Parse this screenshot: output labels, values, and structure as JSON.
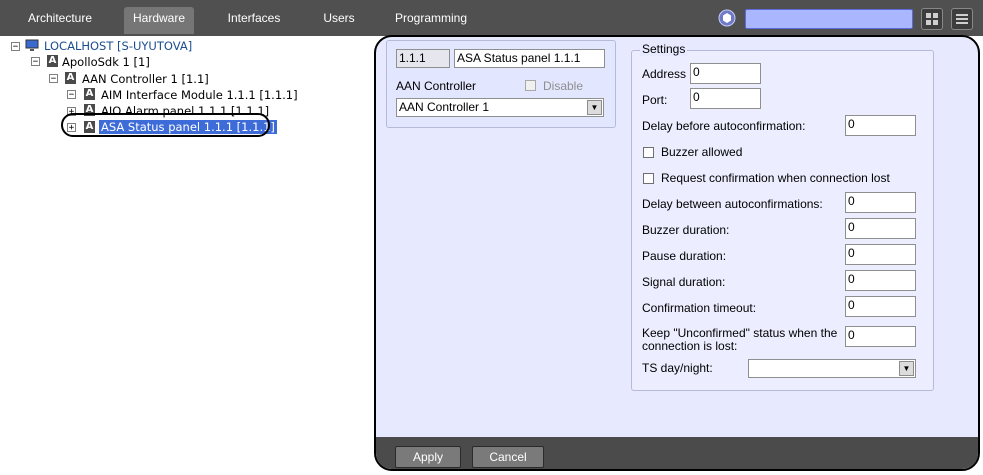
{
  "tabs": [
    {
      "label": "Architecture"
    },
    {
      "label": "Hardware",
      "active": true
    },
    {
      "label": "Interfaces"
    },
    {
      "label": "Users"
    },
    {
      "label": "Programming"
    }
  ],
  "search": {
    "value": ""
  },
  "tree": {
    "nodes": [
      {
        "label": "LOCALHOST [S-UYUTOVA]",
        "icon": "computer-icon"
      },
      {
        "label": "ApolloSdk 1 [1]",
        "icon": "a-device-icon"
      },
      {
        "label": "AAN Controller 1 [1.1]",
        "icon": "a-device-icon"
      },
      {
        "label": "AIM Interface Module 1.1.1 [1.1.1]",
        "icon": "a-device-icon"
      },
      {
        "label": "AIO Alarm panel 1.1.1 [1.1.1]",
        "icon": "a-device-icon"
      },
      {
        "label": "ASA Status panel 1.1.1 [1.1.1]",
        "icon": "a-device-icon",
        "selected": true
      }
    ]
  },
  "device": {
    "id": "1.1.1",
    "name": "ASA Status panel 1.1.1",
    "parent_label": "AAN Controller",
    "disable_label": "Disable",
    "disable_checked": false,
    "parent_value": "AAN Controller 1"
  },
  "settings": {
    "title": "Settings",
    "address_label": "Address",
    "address_value": "0",
    "port_label": "Port:",
    "port_value": "0",
    "delay_before_label": "Delay before autoconfirmation:",
    "delay_before_value": "0",
    "buzzer_allowed_label": "Buzzer allowed",
    "buzzer_allowed_checked": false,
    "request_confirmation_label": "Request confirmation when connection lost",
    "request_confirmation_checked": false,
    "delay_between_label": "Delay between autoconfirmations:",
    "delay_between_value": "0",
    "buzzer_duration_label": "Buzzer duration:",
    "buzzer_duration_value": "0",
    "pause_duration_label": "Pause duration:",
    "pause_duration_value": "0",
    "signal_duration_label": "Signal duration:",
    "signal_duration_value": "0",
    "confirmation_timeout_label": "Confirmation timeout:",
    "confirmation_timeout_value": "0",
    "keep_unconfirmed_label_line1": "Keep \"Unconfirmed\" status when the",
    "keep_unconfirmed_label_line2": "connection is lost:",
    "keep_unconfirmed_value": "0",
    "ts_day_night_label": "TS day/night:",
    "ts_day_night_value": ""
  },
  "buttons": {
    "apply": "Apply",
    "cancel": "Cancel"
  },
  "colors": {
    "topbar": "#505050",
    "panel": "#e7e9ff",
    "selection": "#3d6bd8",
    "search": "#aab7ff"
  }
}
